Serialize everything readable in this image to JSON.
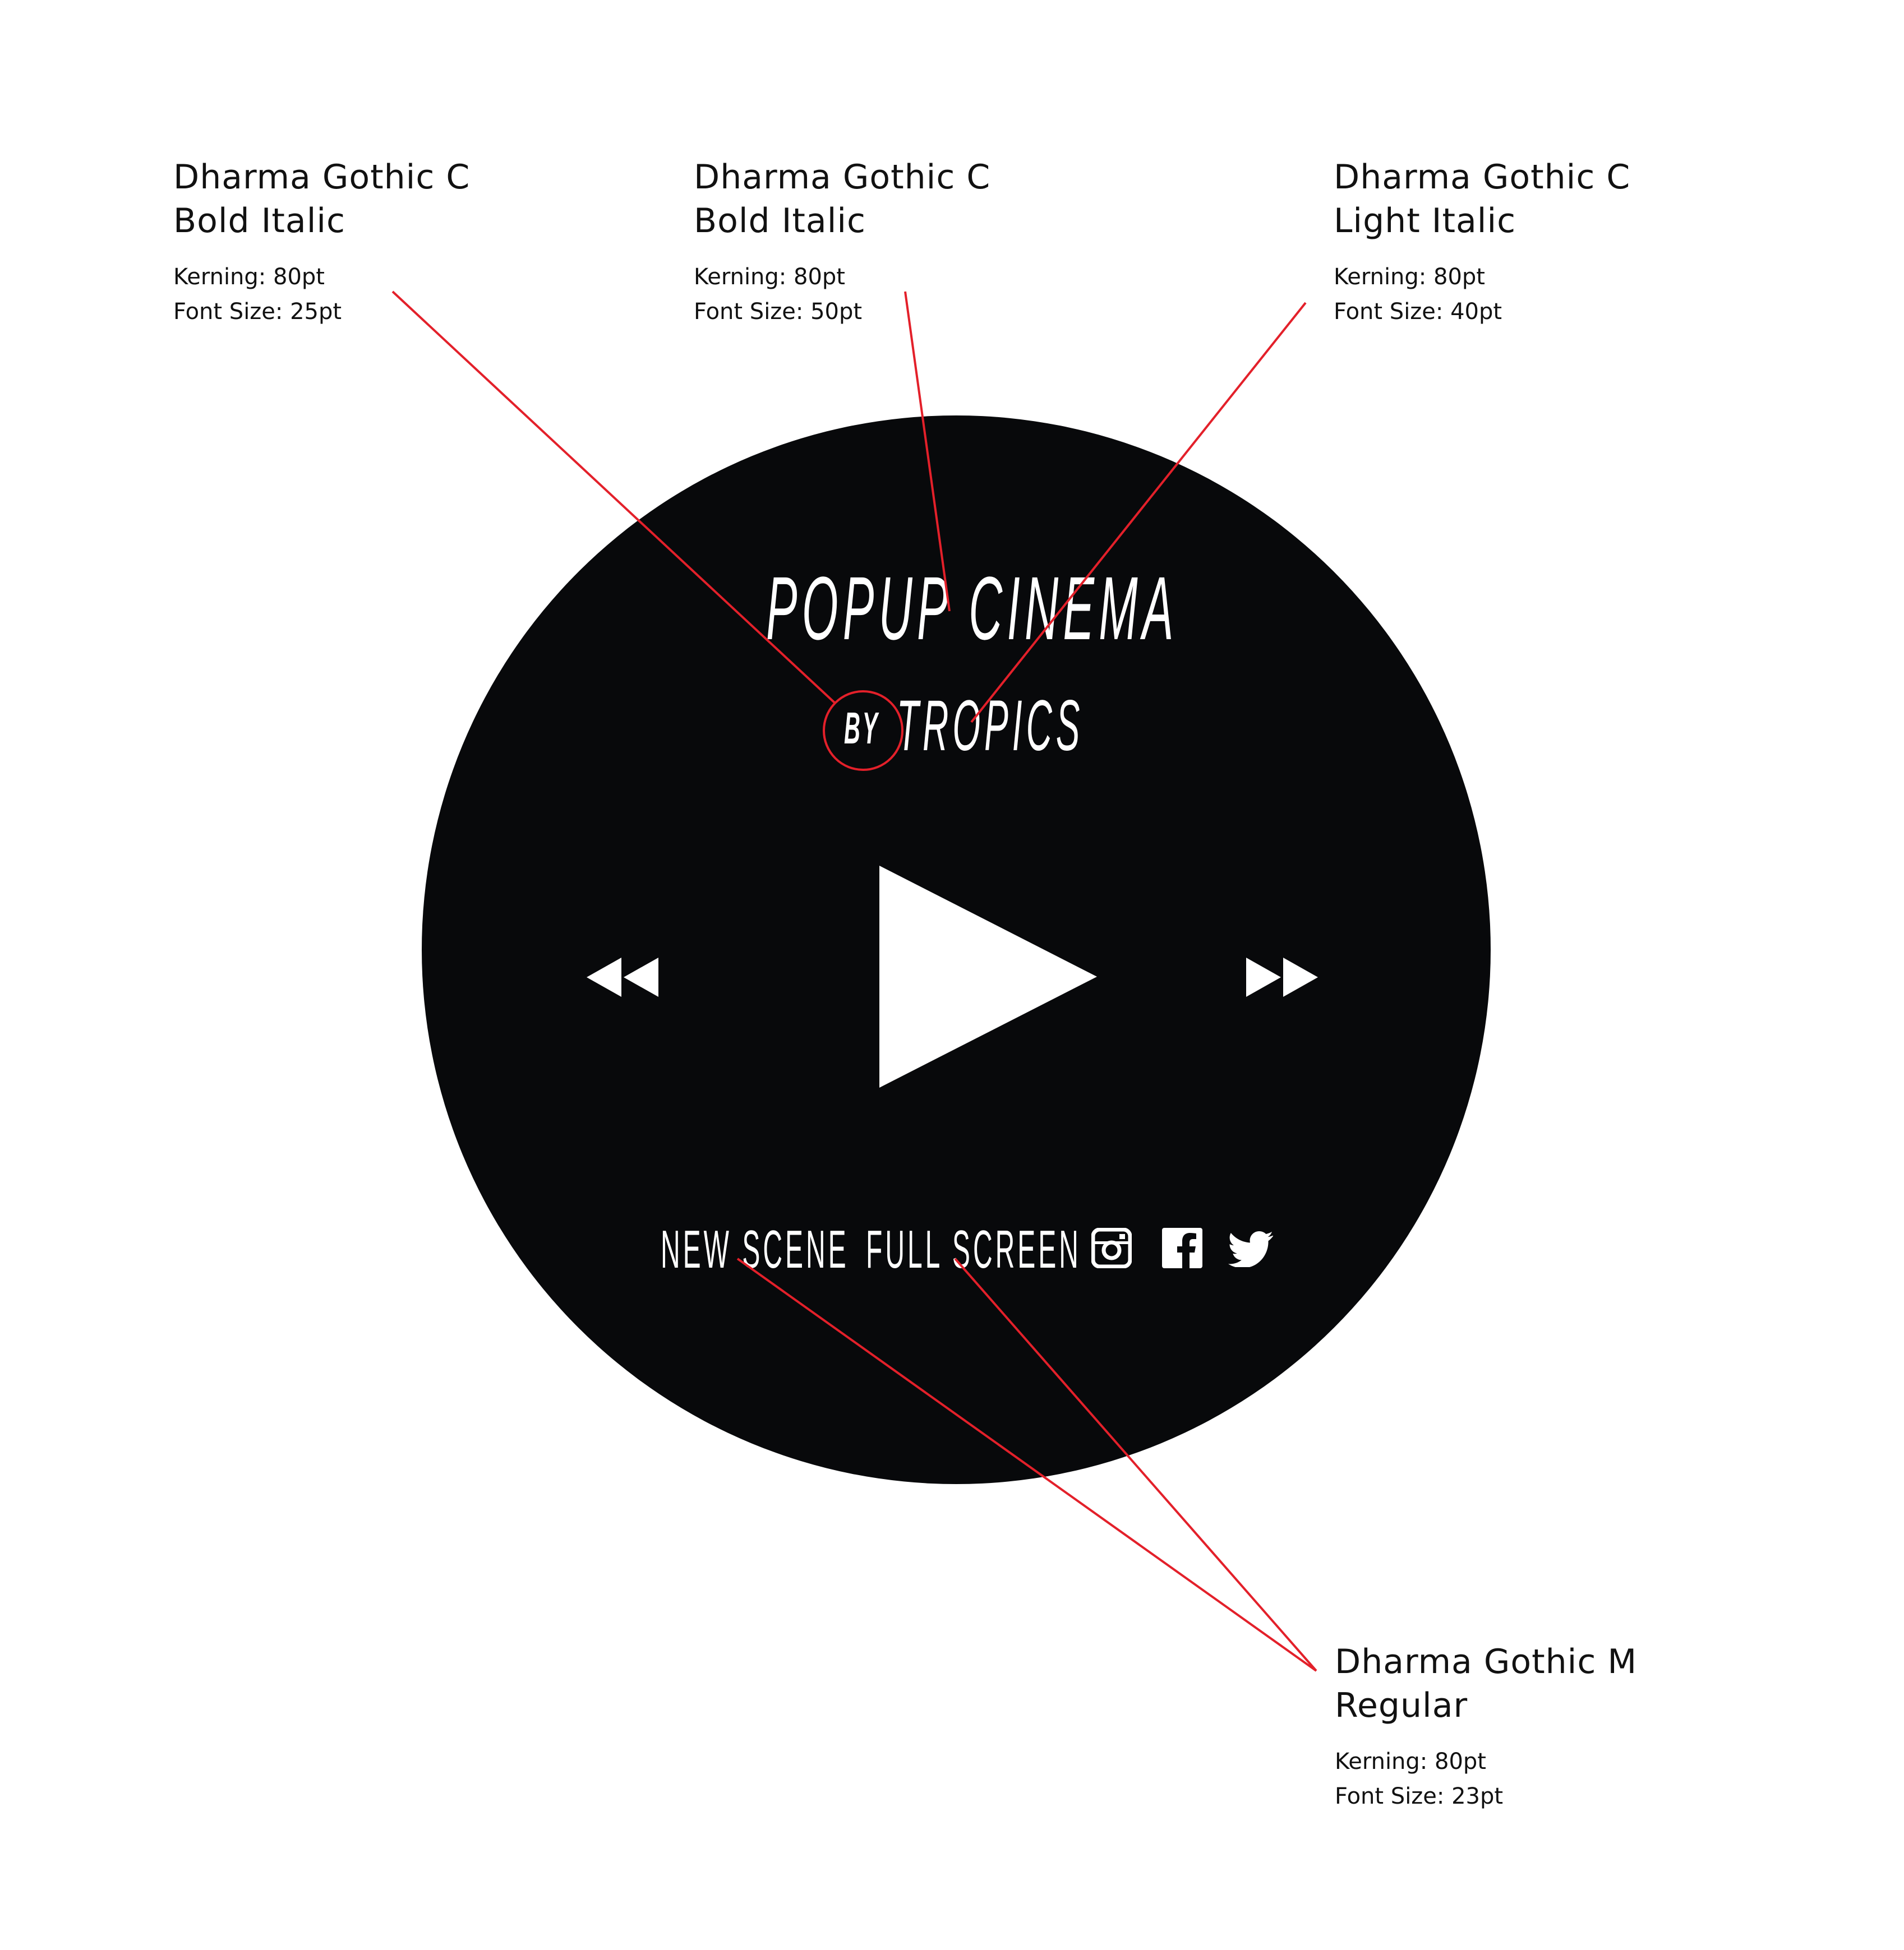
{
  "annotations": [
    {
      "font": "Dharma Gothic C",
      "weight": "Bold Italic",
      "kerning": "Kerning: 80pt",
      "size": "Font Size: 25pt"
    },
    {
      "font": "Dharma Gothic C",
      "weight": "Bold Italic",
      "kerning": "Kerning: 80pt",
      "size": "Font Size: 50pt"
    },
    {
      "font": "Dharma Gothic C",
      "weight": "Light Italic",
      "kerning": "Kerning: 80pt",
      "size": "Font Size: 40pt"
    },
    {
      "font": "Dharma Gothic M",
      "weight": "Regular",
      "kerning": "Kerning: 80pt",
      "size": "Font Size: 23pt"
    }
  ],
  "player": {
    "title": "POPUP CINEMA",
    "by": "BY",
    "subtitle": "TROPICS",
    "controls": {
      "rewind_icon": "rewind-icon",
      "play_icon": "play-icon",
      "forward_icon": "fast-forward-icon"
    },
    "menu": {
      "new_scene": "NEW SCENE",
      "full_screen": "FULL SCREEN"
    },
    "social": [
      "instagram-icon",
      "facebook-icon",
      "twitter-icon"
    ]
  },
  "colors": {
    "background": "#ffffff",
    "disc": "#08090b",
    "foreground": "#ffffff",
    "annotation_line": "#e3202a",
    "annotation_text": "#111111"
  }
}
